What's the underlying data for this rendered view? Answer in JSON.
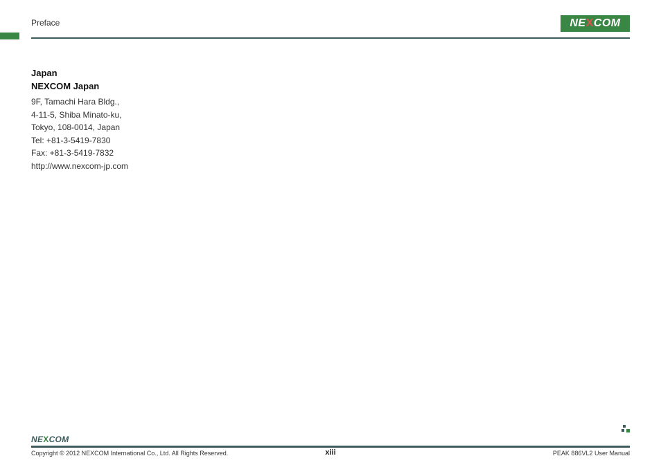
{
  "header": {
    "section_title": "Preface",
    "logo_text_left": "NE",
    "logo_text_x": "X",
    "logo_text_right": "COM"
  },
  "content": {
    "country": "Japan",
    "company": "NEXCOM Japan",
    "address": {
      "line1": "9F, Tamachi Hara Bldg.,",
      "line2": "4-11-5, Shiba Minato-ku,",
      "line3": "Tokyo, 108-0014, Japan",
      "tel": "Tel: +81-3-5419-7830",
      "fax": "Fax: +81-3-5419-7832",
      "url": "http://www.nexcom-jp.com"
    }
  },
  "footer": {
    "logo_text_left": "NE",
    "logo_text_x": "X",
    "logo_text_right": "COM",
    "copyright": "Copyright © 2012 NEXCOM International Co., Ltd. All Rights Reserved.",
    "page_number": "xiii",
    "manual_title": "PEAK 886VL2 User Manual"
  }
}
